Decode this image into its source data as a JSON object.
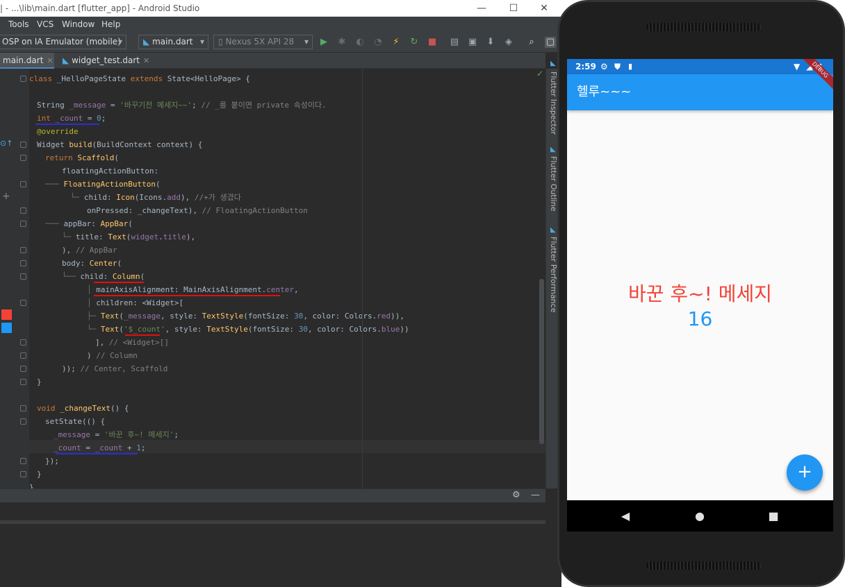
{
  "window": {
    "title": "| - ...\\lib\\main.dart [flutter_app] - Android Studio",
    "controls": {
      "minimize": "—",
      "maximize": "☐",
      "close": "✕"
    }
  },
  "menu": [
    "Tools",
    "VCS",
    "Window",
    "Help"
  ],
  "toolbar": {
    "device_config": "OSP on IA Emulator (mobile)",
    "run_config": "main.dart",
    "target_device": "Nexus 5X API 28"
  },
  "editor_tabs": [
    {
      "label": "main.dart",
      "active": true
    },
    {
      "label": "widget_test.dart",
      "active": false
    }
  ],
  "code_lines": [
    "class _HelloPageState extends State<HelloPage> {",
    "",
    "  String _message = '바꾸기전 메세지~~'; // _를 붙이면 private 속성이다.",
    "  int _count = 0;",
    "  @override",
    "  Widget build(BuildContext context) {",
    "    return Scaffold(",
    "        floatingActionButton:",
    "        FloatingActionButton(",
    "          child: Icon(Icons.add), //+가 생겼다",
    "          onPressed: _changeText), // FloatingActionButton",
    "        appBar: AppBar(",
    "          title: Text(widget.title),",
    "        ), // AppBar",
    "        body: Center(",
    "          child: Column(",
    "            mainAxisAlignment: MainAxisAlignment.center,",
    "            children: <Widget>[",
    "              Text(_message, style: TextStyle(fontSize: 30, color: Colors.red)),",
    "              Text('$_count', style: TextStyle(fontSize: 30, color: Colors.blue))",
    "            ], // <Widget>[]",
    "          ) // Column",
    "        )); // Center, Scaffold",
    "  }",
    "",
    "  void _changeText() {",
    "    setState(() {",
    "      _message = '바꾼 후~! 메세지';",
    "      _count = _count + 1;",
    "    });",
    "  }",
    "}"
  ],
  "right_tool_tabs": [
    "Flutter Inspector",
    "Flutter Outline",
    "Flutter Performance"
  ],
  "phone": {
    "time": "2:59",
    "app_title": "헬루~~~",
    "debug_banner": "DEBUG",
    "message": "바꾼 후~! 메세지",
    "count": "16",
    "fab_icon": "+",
    "nav": {
      "back": "◀",
      "home": "●",
      "recents": "■"
    }
  },
  "colors": {
    "accent": "#2196f3",
    "status": "#1976d2",
    "message_red": "#f44336",
    "ide_bg": "#2b2b2b"
  }
}
